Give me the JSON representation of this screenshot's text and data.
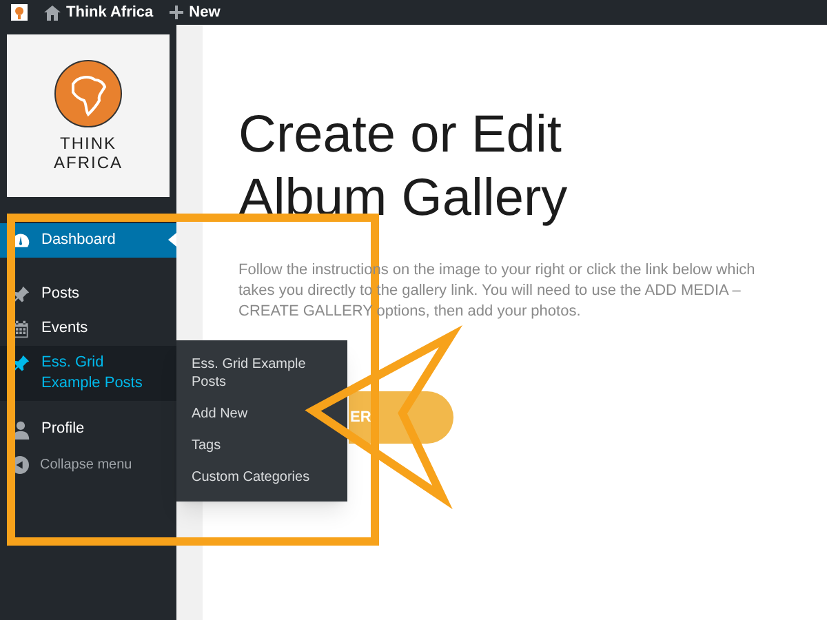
{
  "admin_bar": {
    "site_name": "Think Africa",
    "new_label": "New"
  },
  "logo": {
    "line_1": "THINK",
    "line_2": "AFRICA"
  },
  "sidebar": {
    "items": [
      {
        "kind": "dashboard",
        "label": "Dashboard",
        "selected": true
      },
      {
        "kind": "pin",
        "label": "Posts",
        "selected": false
      },
      {
        "kind": "calendar",
        "label": "Events",
        "selected": false
      },
      {
        "kind": "pin",
        "label": "Ess. Grid Example Posts",
        "selected": false,
        "hovered": true
      },
      {
        "kind": "user",
        "label": "Profile",
        "selected": false
      }
    ],
    "collapse": "Collapse menu"
  },
  "submenu": {
    "items": [
      "Ess. Grid Example Posts",
      "Add New",
      "Tags",
      "Custom Categories"
    ]
  },
  "content": {
    "title": "Create or Edit Album Gallery",
    "body": "Follow the instructions on the image to your right or click the link below which takes you directly to the gallery link. You will need to use the ADD MEDIA – CREATE GALLERY options, then add your photos.",
    "button": "ER"
  }
}
